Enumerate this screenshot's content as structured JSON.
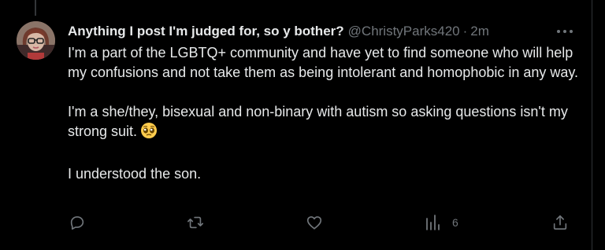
{
  "tweet": {
    "display_name": "Anything I post I'm judged for, so y bother?",
    "handle": "@ChristyParks420",
    "separator": "·",
    "time": "2m",
    "paragraphs": [
      "I'm a part of the LGBTQ+ community and have yet to find someone who will help my confusions and not take them as being intolerant and homophobic in any way.",
      "I'm a she/they, bisexual and non-binary with autism so asking questions isn't my strong suit.",
      "I understood the son."
    ],
    "emoji": "pleading-face",
    "view_count": "6"
  },
  "icons": {
    "reply": "reply-icon",
    "retweet": "retweet-icon",
    "like": "heart-icon",
    "views": "bar-chart-icon",
    "share": "share-icon",
    "more": "more-icon"
  },
  "colors": {
    "background": "#000000",
    "text": "#e7e9ea",
    "muted": "#71767b",
    "border": "#2f3336"
  }
}
